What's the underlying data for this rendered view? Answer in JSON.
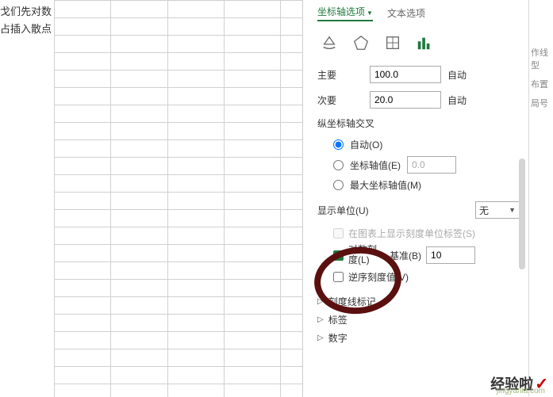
{
  "left_text": {
    "line1": "戈们先对数",
    "line2": "占插入散点"
  },
  "tabs": {
    "axis": "坐标轴选项",
    "text": "文本选项"
  },
  "fields": {
    "major_label": "主要",
    "major_value": "100.0",
    "major_auto": "自动",
    "minor_label": "次要",
    "minor_value": "20.0",
    "minor_auto": "自动"
  },
  "crosses": {
    "title": "纵坐标轴交叉",
    "auto": "自动(O)",
    "at_value": "坐标轴值(E)",
    "at_value_val": "0.0",
    "at_max": "最大坐标轴值(M)"
  },
  "display_units": {
    "label": "显示单位(U)",
    "value": "无",
    "show_labels": "在图表上显示刻度单位标签(S)"
  },
  "log_scale": {
    "label_a": "对数刻",
    "label_b": "度(L)",
    "base_label": "基准(B)",
    "base_value": "10"
  },
  "reverse": "逆序刻度值(V)",
  "expanders": {
    "ticks": "刻度线标记",
    "labels": "标签",
    "number": "数字"
  },
  "right_strip": {
    "i1": "作线型",
    "i2": "布置",
    "i3": "局号"
  },
  "watermark": {
    "brand": "经验啦",
    "url": "jingyanla.com"
  }
}
